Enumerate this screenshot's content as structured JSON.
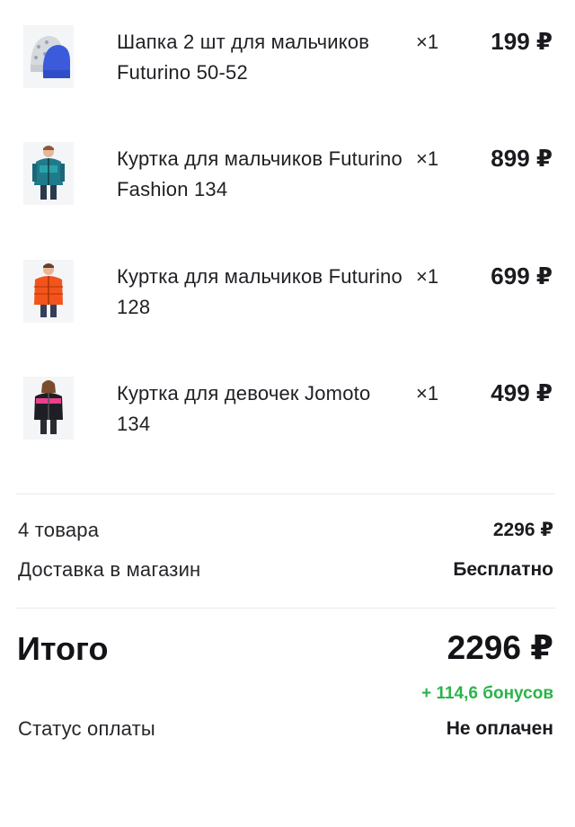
{
  "currency_symbol": "₽",
  "items": [
    {
      "title": "Шапка 2 шт для мальчиков Futurino 50-52",
      "qty": "×1",
      "price": "199 ₽",
      "image_icon": "hat-product-image"
    },
    {
      "title": "Куртка для мальчиков Futurino Fashion 134",
      "qty": "×1",
      "price": "899 ₽",
      "image_icon": "jacket-product-image"
    },
    {
      "title": "Куртка для мальчиков Futurino 128",
      "qty": "×1",
      "price": "699 ₽",
      "image_icon": "jacket-product-image"
    },
    {
      "title": "Куртка для девочек Jomoto 134",
      "qty": "×1",
      "price": "499 ₽",
      "image_icon": "jacket-product-image"
    }
  ],
  "summary": {
    "items_count_label": "4 товара",
    "items_sum": "2296 ₽",
    "delivery_label": "Доставка в магазин",
    "delivery_value": "Бесплатно",
    "total_label": "Итого",
    "total_value": "2296 ₽",
    "bonus_text": "+ 114,6 бонусов",
    "payment_status_label": "Статус оплаты",
    "payment_status_value": "Не оплачен"
  },
  "colors": {
    "text": "#1c1c1e",
    "bonus_green": "#2cb34a",
    "divider": "#e9eaee"
  }
}
